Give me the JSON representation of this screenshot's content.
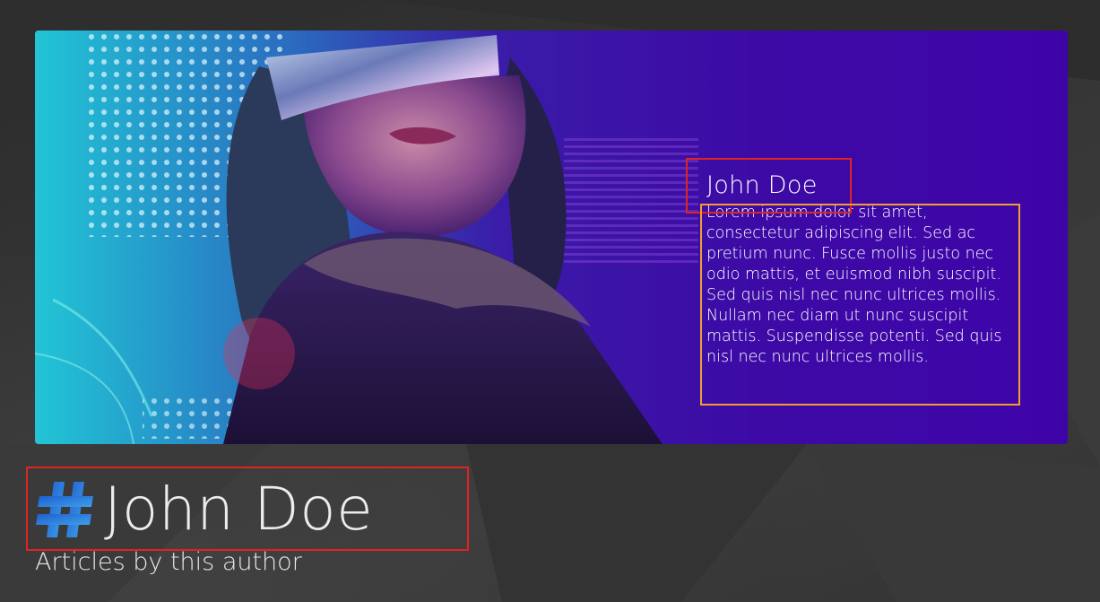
{
  "hero": {
    "author_name": "John Doe",
    "bio": "Lorem ipsum dolor sit amet, consectetur adipiscing elit. Sed ac pretium nunc. Fusce mollis justo nec odio mattis, et euismod nibh suscipit. Sed quis nisl nec nunc ultrices mollis. Nullam nec diam ut nunc suscipit mattis. Suspendisse potenti. Sed quis nisl nec nunc ultrices mollis.",
    "image_icon": "author-portrait-image"
  },
  "header": {
    "title": "John Doe",
    "subtitle": "Articles by this author",
    "hash_icon": "hash-icon"
  },
  "colors": {
    "page_bg": "#343434",
    "hero_purple": "#3f04a8",
    "hero_cyan": "#1aa9c9",
    "hash_gradient_start": "#1e5fd0",
    "hash_gradient_end": "#3fa0e8",
    "text_light": "#ececec",
    "annotation_red": "#e0241f",
    "annotation_orange": "#f0a030"
  }
}
